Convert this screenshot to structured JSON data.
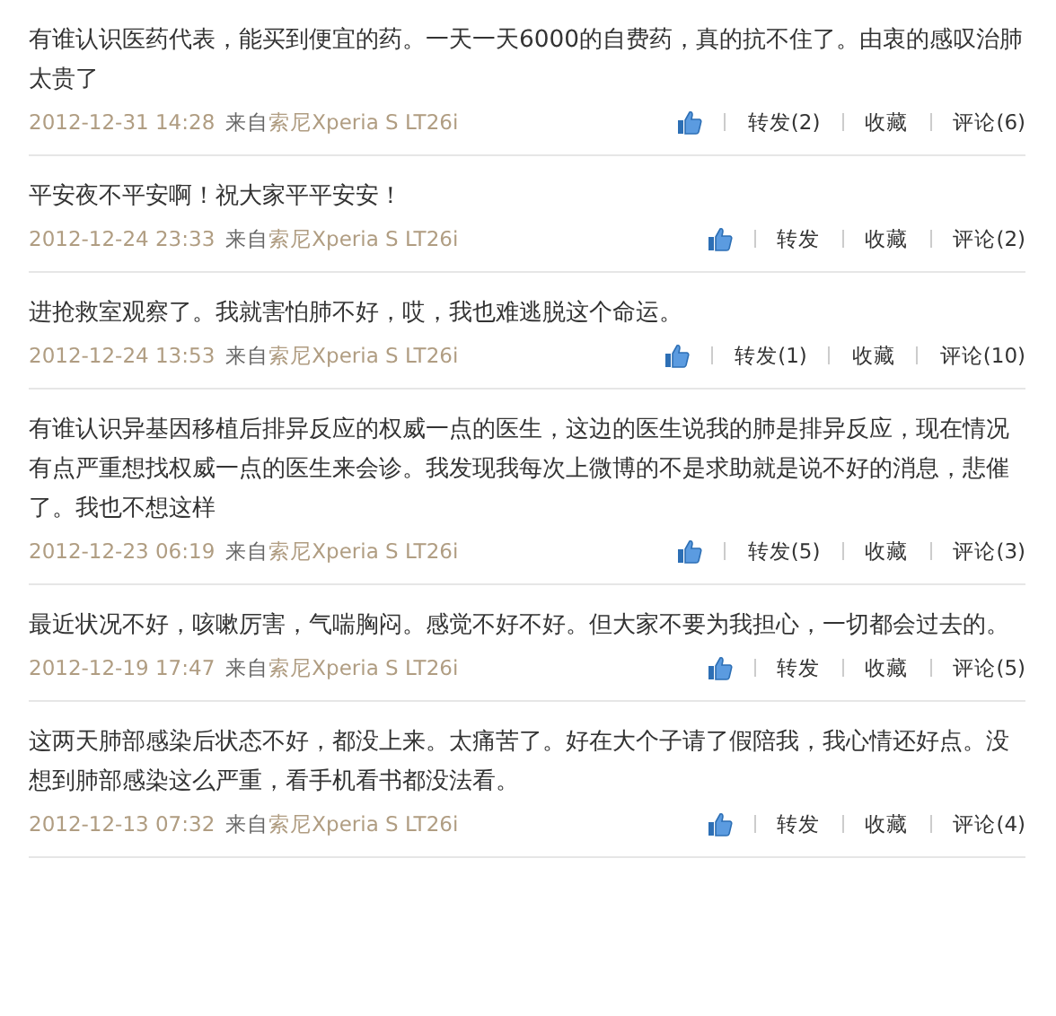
{
  "posts": [
    {
      "text": "有谁认识医药代表，能买到便宜的药。一天一天6000的自费药，真的抗不住了。由衷的感叹治肺太贵了",
      "time": "2012-12-31 14:28",
      "source_label": "来自",
      "source": "索尼Xperia S LT26i",
      "forward": "转发(2)",
      "favorite": "收藏",
      "comment": "评论(6)"
    },
    {
      "text": "平安夜不平安啊！祝大家平平安安！",
      "time": "2012-12-24 23:33",
      "source_label": "来自",
      "source": "索尼Xperia S LT26i",
      "forward": "转发",
      "favorite": "收藏",
      "comment": "评论(2)"
    },
    {
      "text": "进抢救室观察了。我就害怕肺不好，哎，我也难逃脱这个命运。",
      "time": "2012-12-24 13:53",
      "source_label": "来自",
      "source": "索尼Xperia S LT26i",
      "forward": "转发(1)",
      "favorite": "收藏",
      "comment": "评论(10)"
    },
    {
      "text": "有谁认识异基因移植后排异反应的权威一点的医生，这边的医生说我的肺是排异反应，现在情况有点严重想找权威一点的医生来会诊。我发现我每次上微博的不是求助就是说不好的消息，悲催了。我也不想这样",
      "time": "2012-12-23 06:19",
      "source_label": "来自",
      "source": "索尼Xperia S LT26i",
      "forward": "转发(5)",
      "favorite": "收藏",
      "comment": "评论(3)"
    },
    {
      "text": "最近状况不好，咳嗽厉害，气喘胸闷。感觉不好不好。但大家不要为我担心，一切都会过去的。",
      "time": "2012-12-19 17:47",
      "source_label": "来自",
      "source": "索尼Xperia S LT26i",
      "forward": "转发",
      "favorite": "收藏",
      "comment": "评论(5)"
    },
    {
      "text": "这两天肺部感染后状态不好，都没上来。太痛苦了。好在大个子请了假陪我，我心情还好点。没想到肺部感染这么严重，看手机看书都没法看。",
      "time": "2012-12-13 07:32",
      "source_label": "来自",
      "source": "索尼Xperia S LT26i",
      "forward": "转发",
      "favorite": "收藏",
      "comment": "评论(4)"
    }
  ]
}
